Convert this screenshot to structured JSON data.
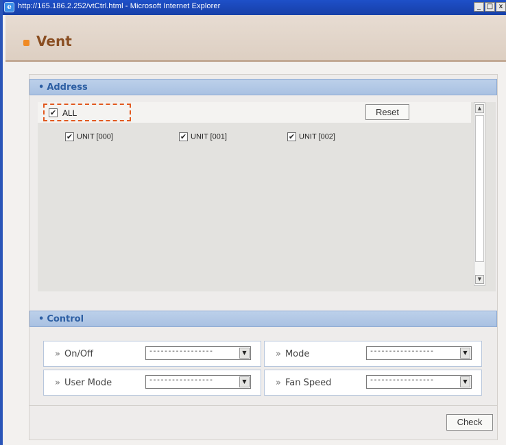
{
  "window": {
    "title": "http://165.186.2.252/vtCtrl.html - Microsoft Internet Explorer",
    "minimize_icon": "minimize-icon",
    "maximize_icon": "maximize-icon",
    "close_icon": "close-icon"
  },
  "header": {
    "title": "Vent",
    "accent_color": "#f08a24"
  },
  "address": {
    "section_label": "Address",
    "all_label": "ALL",
    "all_checked": true,
    "reset_label": "Reset",
    "units": [
      {
        "label": "UNIT [000]",
        "checked": true
      },
      {
        "label": "UNIT [001]",
        "checked": true
      },
      {
        "label": "UNIT [002]",
        "checked": true
      }
    ]
  },
  "control": {
    "section_label": "Control",
    "fields": [
      {
        "label": "On/Off",
        "value": "-----------------"
      },
      {
        "label": "Mode",
        "value": "-----------------"
      },
      {
        "label": "User Mode",
        "value": "-----------------"
      },
      {
        "label": "Fan Speed",
        "value": "-----------------"
      }
    ],
    "check_label": "Check"
  },
  "colors": {
    "titlebar": "#1a46b6",
    "section_bar": "#a9c1e2",
    "highlight_border": "#e2581e",
    "title_text": "#8a4e22"
  }
}
